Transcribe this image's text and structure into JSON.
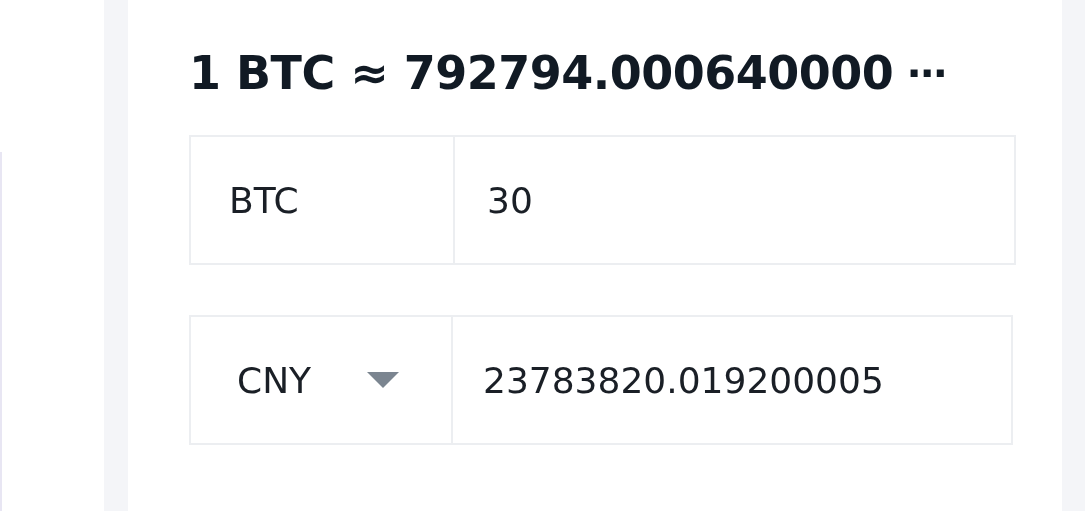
{
  "rate": {
    "text": "1 BTC ≈ 792794.000640000",
    "more": "⋯"
  },
  "from": {
    "currency": "BTC",
    "value": "30"
  },
  "to": {
    "currency": "CNY",
    "value": "23783820.019200005"
  }
}
